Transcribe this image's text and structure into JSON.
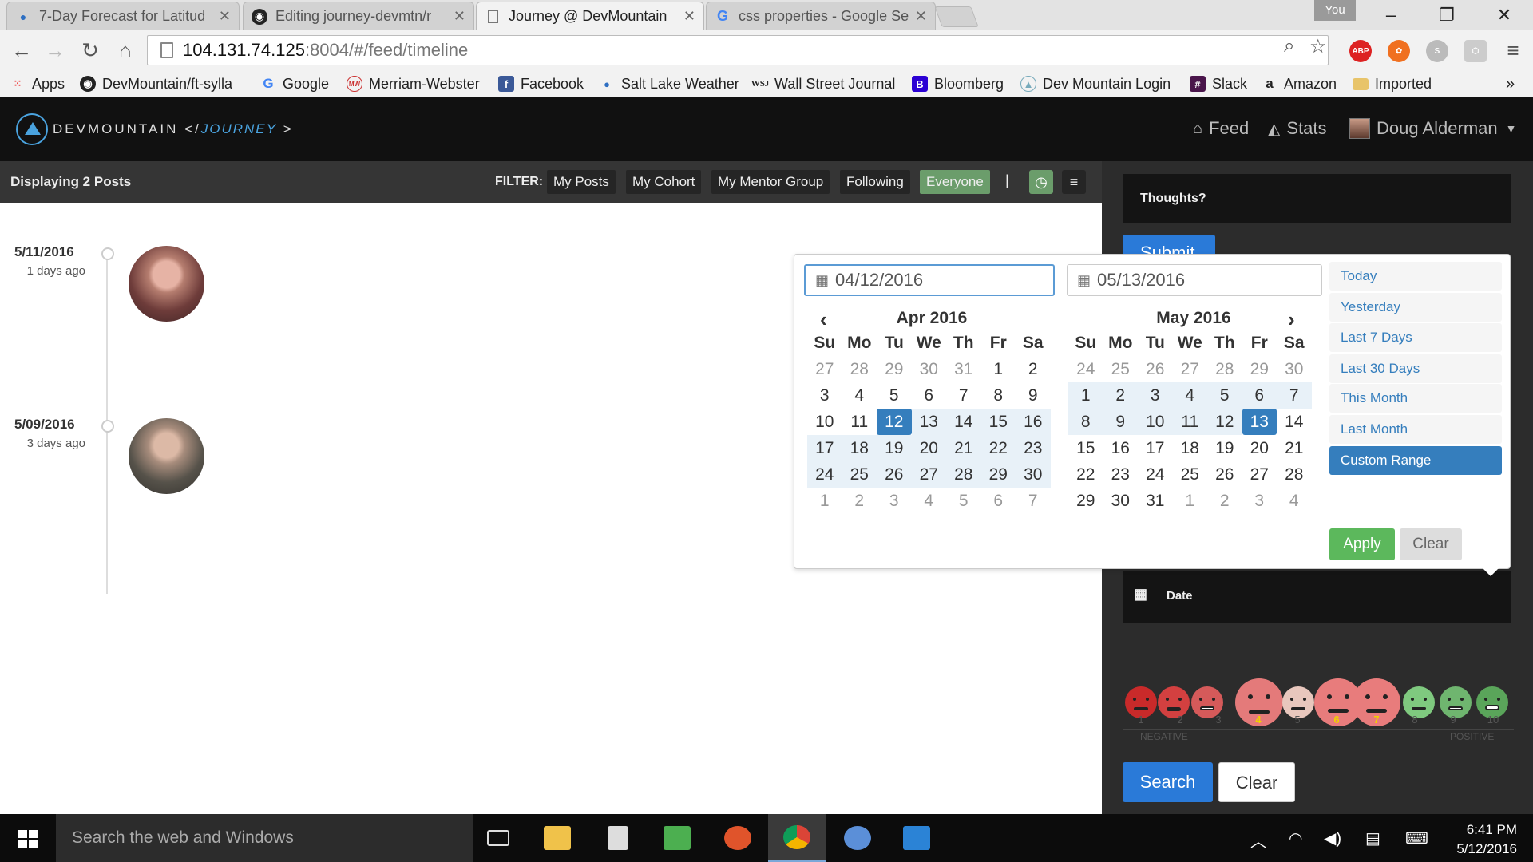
{
  "browser": {
    "tabs": [
      {
        "title": "7-Day Forecast for Latitud",
        "active": false
      },
      {
        "title": "Editing journey-devmtn/r",
        "active": false
      },
      {
        "title": "Journey @ DevMountain",
        "active": true
      },
      {
        "title": "css properties - Google Se",
        "active": false
      }
    ],
    "profile_badge": "You",
    "address_host": "104.131.74.125",
    "address_path": ":8004/#/feed/timeline",
    "extensions": [
      "ABP"
    ],
    "bookmarks": [
      {
        "label": "Apps",
        "icon": "apps-grid-icon"
      },
      {
        "label": "DevMountain/ft-sylla",
        "icon": "github-icon"
      },
      {
        "label": "Google",
        "icon": "google-icon"
      },
      {
        "label": "Merriam-Webster",
        "icon": "merriam-webster-icon"
      },
      {
        "label": "Facebook",
        "icon": "facebook-icon"
      },
      {
        "label": "Salt Lake Weather",
        "icon": "weather-icon"
      },
      {
        "label": "Wall Street Journal",
        "icon": "wsj-icon"
      },
      {
        "label": "Bloomberg",
        "icon": "bloomberg-icon"
      },
      {
        "label": "Dev Mountain Login",
        "icon": "devmountain-icon"
      },
      {
        "label": "Slack",
        "icon": "slack-icon"
      },
      {
        "label": "Amazon",
        "icon": "amazon-icon"
      },
      {
        "label": "Imported",
        "icon": "folder-icon"
      }
    ],
    "bookmarks_overflow": "»"
  },
  "app": {
    "brand": "DEVMOUNTAIN </",
    "brand_sub": "JOURNEY",
    "brand_chevron": ">",
    "nav_feed": "Feed",
    "nav_stats": "Stats",
    "user_name": "Doug Alderman"
  },
  "filter": {
    "display_text": "Displaying 2 Posts",
    "label": "FILTER:",
    "buttons": [
      "My Posts",
      "My Cohort",
      "My Mentor Group",
      "Following",
      "Everyone"
    ],
    "active": "Everyone",
    "divider": "|"
  },
  "timeline": [
    {
      "date": "5/11/2016",
      "ago": "1 days ago"
    },
    {
      "date": "5/09/2016",
      "ago": "3 days ago"
    }
  ],
  "sidebar": {
    "thoughts_label": "Thoughts?",
    "submit_label": "Submit",
    "date_label": "Date",
    "mood_numbers": [
      "1",
      "2",
      "3",
      "4",
      "5",
      "6",
      "7",
      "8",
      "9",
      "10"
    ],
    "highlighted_moods": [
      "4",
      "6",
      "7"
    ],
    "scale_negative": "NEGATIVE",
    "scale_positive": "POSITIVE",
    "search_label": "Search",
    "clear_label": "Clear"
  },
  "picker": {
    "start_value": "04/12/2016",
    "end_value": "05/13/2016",
    "left_month": "Apr 2016",
    "right_month": "May 2016",
    "weekdays": [
      "Su",
      "Mo",
      "Tu",
      "We",
      "Th",
      "Fr",
      "Sa"
    ],
    "left_days": [
      "27",
      "28",
      "29",
      "30",
      "31",
      "1",
      "2",
      "3",
      "4",
      "5",
      "6",
      "7",
      "8",
      "9",
      "10",
      "11",
      "12",
      "13",
      "14",
      "15",
      "16",
      "17",
      "18",
      "19",
      "20",
      "21",
      "22",
      "23",
      "24",
      "25",
      "26",
      "27",
      "28",
      "29",
      "30",
      "1",
      "2",
      "3",
      "4",
      "5",
      "6",
      "7"
    ],
    "right_days": [
      "24",
      "25",
      "26",
      "27",
      "28",
      "29",
      "30",
      "1",
      "2",
      "3",
      "4",
      "5",
      "6",
      "7",
      "8",
      "9",
      "10",
      "11",
      "12",
      "13",
      "14",
      "15",
      "16",
      "17",
      "18",
      "19",
      "20",
      "21",
      "22",
      "23",
      "24",
      "25",
      "26",
      "27",
      "28",
      "29",
      "30",
      "31",
      "1",
      "2",
      "3",
      "4"
    ],
    "ranges": [
      "Today",
      "Yesterday",
      "Last 7 Days",
      "Last 30 Days",
      "This Month",
      "Last Month",
      "Custom Range"
    ],
    "active_range": "Custom Range",
    "apply_label": "Apply",
    "clear_label": "Clear"
  },
  "taskbar": {
    "search_placeholder": "Search the web and Windows",
    "time": "6:41 PM",
    "date": "5/12/2016"
  },
  "colors": {
    "accent_blue": "#357ebd",
    "button_blue": "#2a7ad8",
    "apply_green": "#5cb85c",
    "active_filter": "#6b9d6b"
  }
}
